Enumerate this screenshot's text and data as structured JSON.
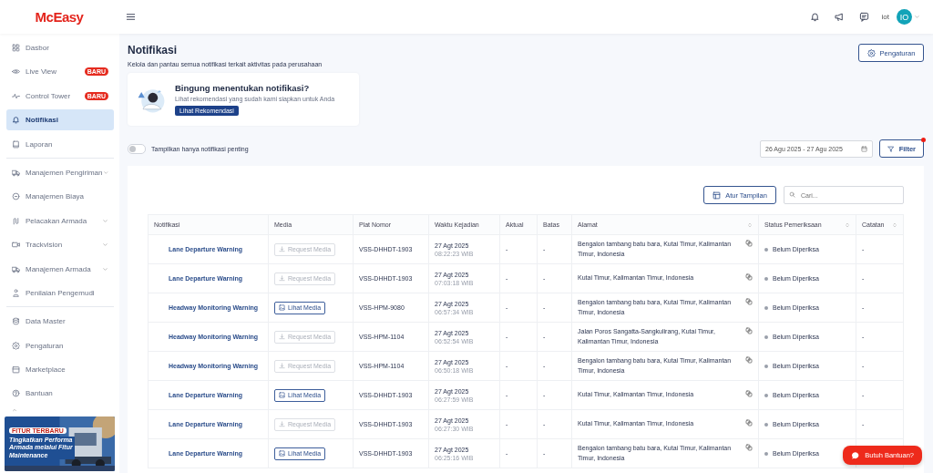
{
  "header": {
    "logo": "McEasy",
    "user": "iot",
    "avatar": "IO"
  },
  "sidebar": {
    "items": [
      {
        "label": "Dasbor",
        "selected": false
      },
      {
        "label": "Live View",
        "badge": "BARU",
        "selected": false
      },
      {
        "label": "Control Tower",
        "badge": "BARU",
        "selected": false
      },
      {
        "label": "Notifikasi",
        "selected": true
      },
      {
        "label": "Laporan",
        "selected": false,
        "divider_after": true
      },
      {
        "label": "Manajemen Pengiriman",
        "expandable": true,
        "selected": false
      },
      {
        "label": "Manajemen Biaya",
        "selected": false
      },
      {
        "label": "Pelacakan Armada",
        "expandable": true,
        "selected": false
      },
      {
        "label": "Trackvision",
        "expandable": true,
        "selected": false
      },
      {
        "label": "Manajemen Armada",
        "expandable": true,
        "selected": false
      },
      {
        "label": "Penilaian Pengemudi",
        "selected": false,
        "divider_after": true
      },
      {
        "label": "Data Master",
        "selected": false
      },
      {
        "label": "Pengaturan",
        "selected": false
      },
      {
        "label": "Marketplace",
        "selected": false
      },
      {
        "label": "Bantuan",
        "selected": false
      }
    ],
    "banner": {
      "tag": "FITUR TERBARU",
      "headline": "Tingkatkan Performa Armada melalui Fitur Maintenance"
    }
  },
  "page": {
    "title": "Notifikasi",
    "subtitle": "Kelola dan pantau semua notifikasi terkait aktivitas pada perusahaan",
    "settings_button": "Pengaturan"
  },
  "recommendation": {
    "title": "Bingung menentukan notifikasi?",
    "text": "Lihat rekomendasi yang sudah kami siapkan untuk Anda",
    "button": "Lihat Rekomendasi"
  },
  "filters": {
    "important_only": {
      "label": "Tampilkan hanya notifikasi penting",
      "on": false
    },
    "date_range": "26 Agu 2025 - 27 Agu 2025",
    "filter_button": "Filter",
    "filter_active": true
  },
  "table": {
    "view_button": "Atur Tampilan",
    "search": {
      "placeholder": "Cari..."
    },
    "columns": [
      {
        "label": "Notifikasi"
      },
      {
        "label": "Media"
      },
      {
        "label": "Plat Nomor"
      },
      {
        "label": "Waktu Kejadian"
      },
      {
        "label": "Aktual"
      },
      {
        "label": "Batas"
      },
      {
        "label": "Alamat",
        "sortable": true
      },
      {
        "label": "Status Pemeriksaan",
        "sortable": true
      },
      {
        "label": "Catatan",
        "sortable": true
      }
    ],
    "rows": [
      {
        "notification": "Lane Departure Warning",
        "media": {
          "kind": "request",
          "label": "Request Media",
          "disabled": true
        },
        "plate": "VSS-DHHDT-1903",
        "date": "27 Agt 2025",
        "time": "08:22:23 WIB",
        "actual": "-",
        "limit": "-",
        "address": "Bengalon tambang batu bara, Kutai Timur, Kalimantan Timur, Indonesia",
        "status": "Belum Diperiksa",
        "note": "-"
      },
      {
        "notification": "Lane Departure Warning",
        "media": {
          "kind": "request",
          "label": "Request Media",
          "disabled": true
        },
        "plate": "VSS-DHHDT-1903",
        "date": "27 Agt 2025",
        "time": "07:03:18 WIB",
        "actual": "-",
        "limit": "-",
        "address": "Kutai Timur, Kalimantan Timur, Indonesia",
        "status": "Belum Diperiksa",
        "note": "-"
      },
      {
        "notification": "Headway Monitoring Warning",
        "media": {
          "kind": "view",
          "label": "Lihat Media",
          "disabled": false
        },
        "plate": "VSS-HPM-9080",
        "date": "27 Agt 2025",
        "time": "06:57:34 WIB",
        "actual": "-",
        "limit": "-",
        "address": "Bengalon tambang batu bara, Kutai Timur, Kalimantan Timur, Indonesia",
        "status": "Belum Diperiksa",
        "note": "-"
      },
      {
        "notification": "Headway Monitoring Warning",
        "media": {
          "kind": "request",
          "label": "Request Media",
          "disabled": true
        },
        "plate": "VSS-HPM-1104",
        "date": "27 Agt 2025",
        "time": "06:52:54 WIB",
        "actual": "-",
        "limit": "-",
        "address": "Jalan Poros Sangatta-Sangkulirang, Kutai Timur, Kalimantan Timur, Indonesia",
        "status": "Belum Diperiksa",
        "note": "-"
      },
      {
        "notification": "Headway Monitoring Warning",
        "media": {
          "kind": "request",
          "label": "Request Media",
          "disabled": true
        },
        "plate": "VSS-HPM-1104",
        "date": "27 Agt 2025",
        "time": "06:50:18 WIB",
        "actual": "-",
        "limit": "-",
        "address": "Bengalon tambang batu bara, Kutai Timur, Kalimantan Timur, Indonesia",
        "status": "Belum Diperiksa",
        "note": "-"
      },
      {
        "notification": "Lane Departure Warning",
        "media": {
          "kind": "view",
          "label": "Lihat Media",
          "disabled": false
        },
        "plate": "VSS-DHHDT-1903",
        "date": "27 Agt 2025",
        "time": "06:27:59 WIB",
        "actual": "-",
        "limit": "-",
        "address": "Kutai Timur, Kalimantan Timur, Indonesia",
        "status": "Belum Diperiksa",
        "note": "-"
      },
      {
        "notification": "Lane Departure Warning",
        "media": {
          "kind": "request",
          "label": "Request Media",
          "disabled": true
        },
        "plate": "VSS-DHHDT-1903",
        "date": "27 Agt 2025",
        "time": "06:27:30 WIB",
        "actual": "-",
        "limit": "-",
        "address": "Kutai Timur, Kalimantan Timur, Indonesia",
        "status": "Belum Diperiksa",
        "note": "-"
      },
      {
        "notification": "Lane Departure Warning",
        "media": {
          "kind": "view",
          "label": "Lihat Media",
          "disabled": false
        },
        "plate": "VSS-DHHDT-1903",
        "date": "27 Agt 2025",
        "time": "06:25:16 WIB",
        "actual": "-",
        "limit": "-",
        "address": "Bengalon tambang batu bara, Kutai Timur, Kalimantan Timur, Indonesia",
        "status": "Belum Diperiksa"
      }
    ]
  },
  "help_button": "Butuh Bantuan?"
}
